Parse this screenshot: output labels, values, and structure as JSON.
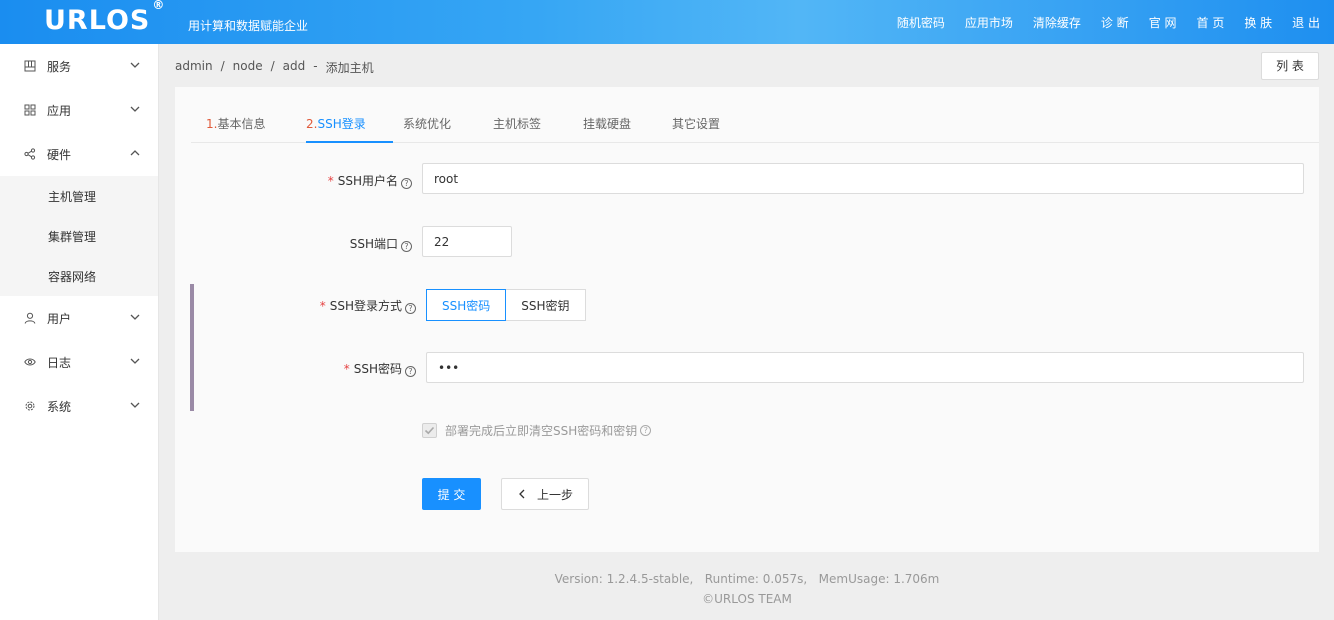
{
  "header": {
    "logo": "URLOS",
    "logo_mark": "®",
    "slogan": "用计算和数据赋能企业",
    "nav": [
      "随机密码",
      "应用市场",
      "清除缓存",
      "诊 断",
      "官 网",
      "首 页",
      "换 肤",
      "退 出"
    ]
  },
  "sidebar": {
    "items": [
      {
        "label": "服务",
        "icon": "grid-icon"
      },
      {
        "label": "应用",
        "icon": "apps-icon"
      },
      {
        "label": "硬件",
        "icon": "share-icon"
      },
      {
        "label": "用户",
        "icon": "user-icon"
      },
      {
        "label": "日志",
        "icon": "eye-icon"
      },
      {
        "label": "系统",
        "icon": "gear-icon"
      }
    ],
    "sub_items": [
      "主机管理",
      "集群管理",
      "容器网络"
    ]
  },
  "breadcrumb": {
    "items": [
      "admin",
      "/",
      "node",
      "/",
      "add",
      "-",
      "添加主机"
    ]
  },
  "list_button": "列 表",
  "tabs": [
    {
      "num": "1.",
      "label": "基本信息"
    },
    {
      "num": "2.",
      "label": "SSH登录"
    },
    {
      "label": "系统优化"
    },
    {
      "label": "主机标签"
    },
    {
      "label": "挂载硬盘"
    },
    {
      "label": "其它设置"
    }
  ],
  "form": {
    "required_mark": "*",
    "help_mark": "?",
    "ssh_user_label": "SSH用户名",
    "ssh_user_value": "root",
    "ssh_port_label": "SSH端口",
    "ssh_port_value": "22",
    "ssh_login_label": "SSH登录方式",
    "ssh_login_options": [
      "SSH密码",
      "SSH密钥"
    ],
    "ssh_password_label": "SSH密码",
    "ssh_password_value": "•••",
    "clear_checkbox_label": "部署完成后立即清空SSH密码和密钥",
    "submit_button": "提 交",
    "prev_button": "上一步"
  },
  "footer": {
    "line1": "Version: 1.2.4.5-stable,   Runtime: 0.057s,   MemUsage: 1.706m",
    "line2": "©URLOS TEAM"
  },
  "colors": {
    "primary": "#1890ff",
    "header": "#2c9cf2",
    "required": "#e54040"
  }
}
